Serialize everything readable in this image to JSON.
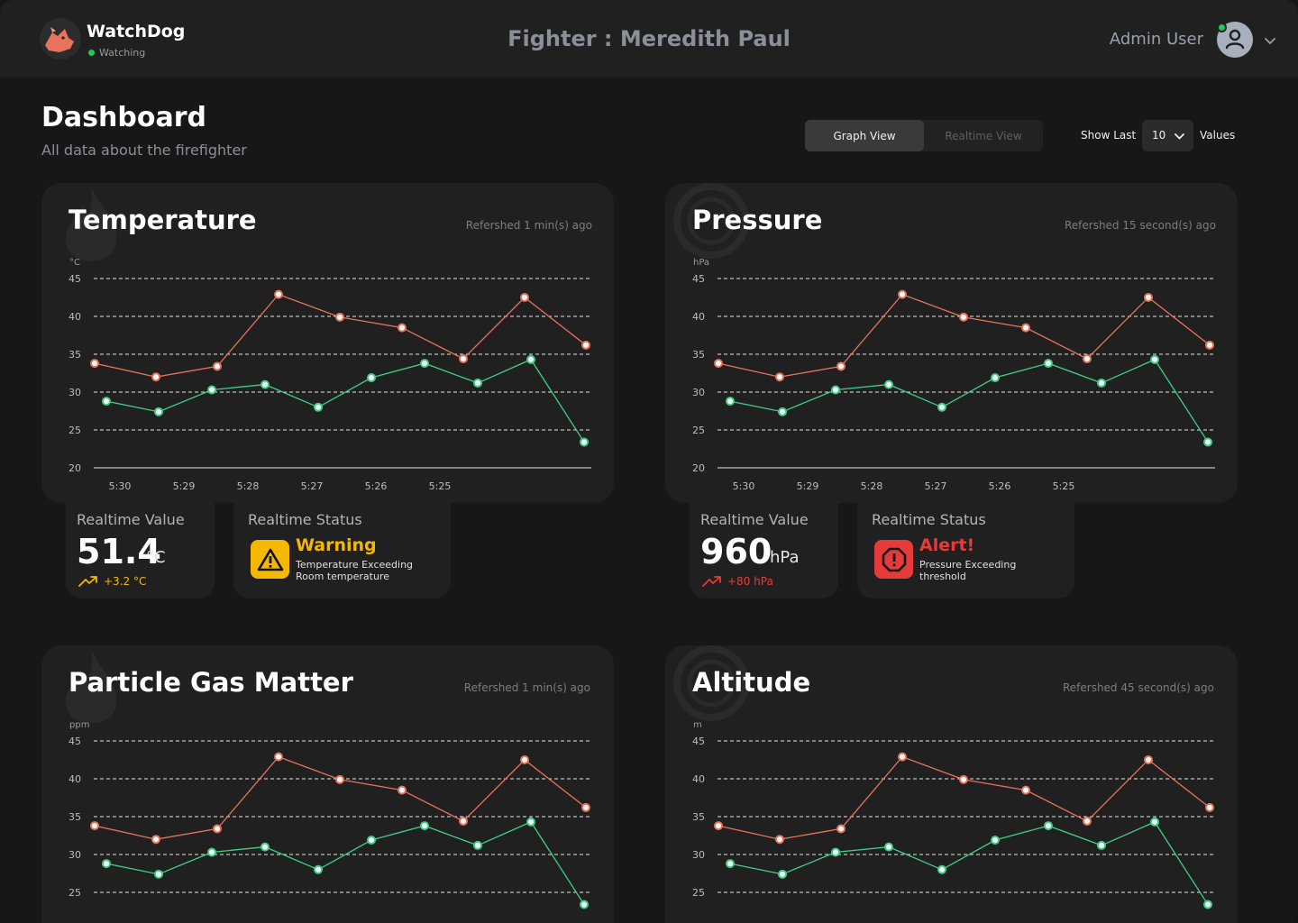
{
  "app": {
    "name": "WatchDog",
    "status": "Watching"
  },
  "header": {
    "fighter_title": "Fighter : Meredith Paul",
    "user_name": "Admin User"
  },
  "page": {
    "title": "Dashboard",
    "subtitle": "All data about the firefighter"
  },
  "view_toggle": {
    "graph": "Graph View",
    "realtime": "Realtime View",
    "active": "graph"
  },
  "show_last": {
    "label": "Show Last",
    "value": "10",
    "suffix": "Values"
  },
  "colors": {
    "red_series": "#e8735a",
    "green_series": "#3fcf85",
    "warning": "#f5b800",
    "alert": "#e63b3b"
  },
  "cards": [
    {
      "title": "Temperature",
      "refreshed": "Refershed 1 min(s) ago",
      "unit": "°C",
      "realtime_label": "Realtime Value",
      "value": "51.4",
      "value_unit": "°C",
      "delta": "+3.2 °C",
      "delta_color": "#f5b800",
      "status_label": "Realtime Status",
      "status_title": "Warning",
      "status_line1": "Temperature Exceeding",
      "status_line2": "Room temperature",
      "status_color": "#f5b800",
      "status_icon": "warning-triangle-icon"
    },
    {
      "title": "Pressure",
      "refreshed": "Refershed 15 second(s) ago",
      "unit": "hPa",
      "realtime_label": "Realtime Value",
      "value": "960",
      "value_unit": "hPa",
      "delta": "+80 hPa",
      "delta_color": "#e63b3b",
      "status_label": "Realtime Status",
      "status_title": "Alert!",
      "status_line1": "Pressure Exceeding",
      "status_line2": "threshold",
      "status_color": "#e63b3b",
      "status_icon": "alert-octagon-icon"
    },
    {
      "title": "Particle Gas Matter",
      "refreshed": "Refershed 1 min(s) ago",
      "unit": "ppm"
    },
    {
      "title": "Altitude",
      "refreshed": "Refershed 45 second(s) ago",
      "unit": "m"
    }
  ],
  "chart_data": [
    {
      "type": "line",
      "title": "Temperature",
      "ylabel": "°C",
      "ylim": [
        20,
        45
      ],
      "grid": true,
      "y_ticks": [
        45,
        40,
        35,
        30,
        25,
        20
      ],
      "x_tick_labels": [
        "5:30",
        "5:29",
        "5:28",
        "5:27",
        "5:26",
        "5:25"
      ],
      "series": [
        {
          "values": [
            33.8,
            32.0,
            33.4,
            42.9,
            39.9,
            38.5,
            34.4,
            42.5,
            36.2
          ],
          "color": "#e8735a"
        },
        {
          "values": [
            28.8,
            27.4,
            30.3,
            31.0,
            28.0,
            31.9,
            33.8,
            31.2,
            34.3,
            23.4
          ],
          "color": "#3fcf85"
        }
      ]
    },
    {
      "type": "line",
      "title": "Pressure",
      "ylabel": "hPa",
      "ylim": [
        20,
        45
      ],
      "grid": true,
      "y_ticks": [
        45,
        40,
        35,
        30,
        25,
        20
      ],
      "x_tick_labels": [
        "5:30",
        "5:29",
        "5:28",
        "5:27",
        "5:26",
        "5:25"
      ],
      "series": [
        {
          "values": [
            33.8,
            32.0,
            33.4,
            42.9,
            39.9,
            38.5,
            34.4,
            42.5,
            36.2
          ],
          "color": "#e8735a"
        },
        {
          "values": [
            28.8,
            27.4,
            30.3,
            31.0,
            28.0,
            31.9,
            33.8,
            31.2,
            34.3,
            23.4
          ],
          "color": "#3fcf85"
        }
      ]
    },
    {
      "type": "line",
      "title": "Particle Gas Matter",
      "ylabel": "ppm",
      "ylim": [
        20,
        45
      ],
      "grid": true,
      "y_ticks": [
        45,
        40,
        35,
        30,
        25
      ],
      "x_tick_labels": [],
      "series": [
        {
          "values": [
            33.8,
            32.0,
            33.4,
            42.9,
            39.9,
            38.5,
            34.4,
            42.5,
            36.2
          ],
          "color": "#e8735a"
        },
        {
          "values": [
            28.8,
            27.4,
            30.3,
            31.0,
            28.0,
            31.9,
            33.8,
            31.2,
            34.3,
            23.4
          ],
          "color": "#3fcf85"
        }
      ]
    },
    {
      "type": "line",
      "title": "Altitude",
      "ylabel": "m",
      "ylim": [
        20,
        45
      ],
      "grid": true,
      "y_ticks": [
        45,
        40,
        35,
        30,
        25
      ],
      "x_tick_labels": [],
      "series": [
        {
          "values": [
            33.8,
            32.0,
            33.4,
            42.9,
            39.9,
            38.5,
            34.4,
            42.5,
            36.2
          ],
          "color": "#e8735a"
        },
        {
          "values": [
            28.8,
            27.4,
            30.3,
            31.0,
            28.0,
            31.9,
            33.8,
            31.2,
            34.3,
            23.4
          ],
          "color": "#3fcf85"
        }
      ]
    }
  ]
}
